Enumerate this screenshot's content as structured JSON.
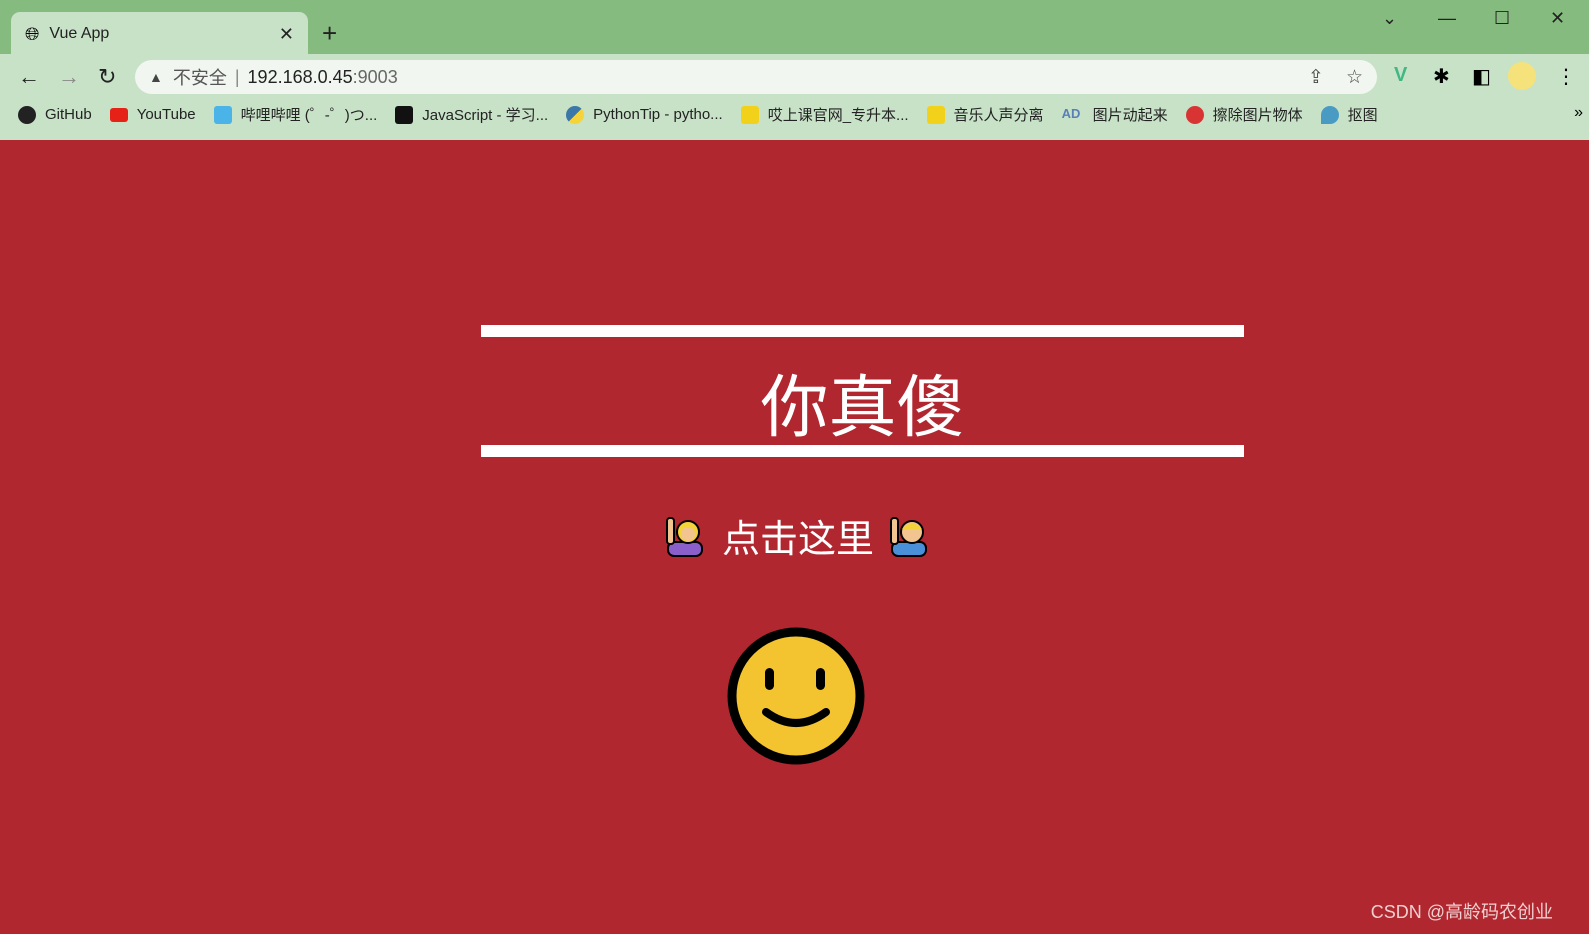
{
  "browser": {
    "tab_title": "Vue App",
    "address_warning": "不安全",
    "address_host": "192.168.0.45",
    "address_port": ":9003",
    "bookmarks": [
      {
        "label": "GitHub",
        "color": "#222222"
      },
      {
        "label": "YouTube",
        "color": "#e62117"
      },
      {
        "label": "哔哩哔哩 (゜-゜)つ...",
        "color": "#4ab3e8"
      },
      {
        "label": "JavaScript - 学习...",
        "color": "#111111"
      },
      {
        "label": "PythonTip - pytho...",
        "color": "#3b77a8"
      },
      {
        "label": "哎上课官网_专升本...",
        "color": "#f2d11b"
      },
      {
        "label": "音乐人声分离",
        "color": "#f2d11b"
      },
      {
        "label": "图片动起来",
        "color": "#5a7fb8"
      },
      {
        "label": "擦除图片物体",
        "color": "#d93434"
      },
      {
        "label": "抠图",
        "color": "#4a9bc4"
      }
    ]
  },
  "page": {
    "heading": "你真傻",
    "click_text": "点击这里",
    "background": "#b0272f"
  },
  "watermark": "CSDN @高龄码农创业"
}
